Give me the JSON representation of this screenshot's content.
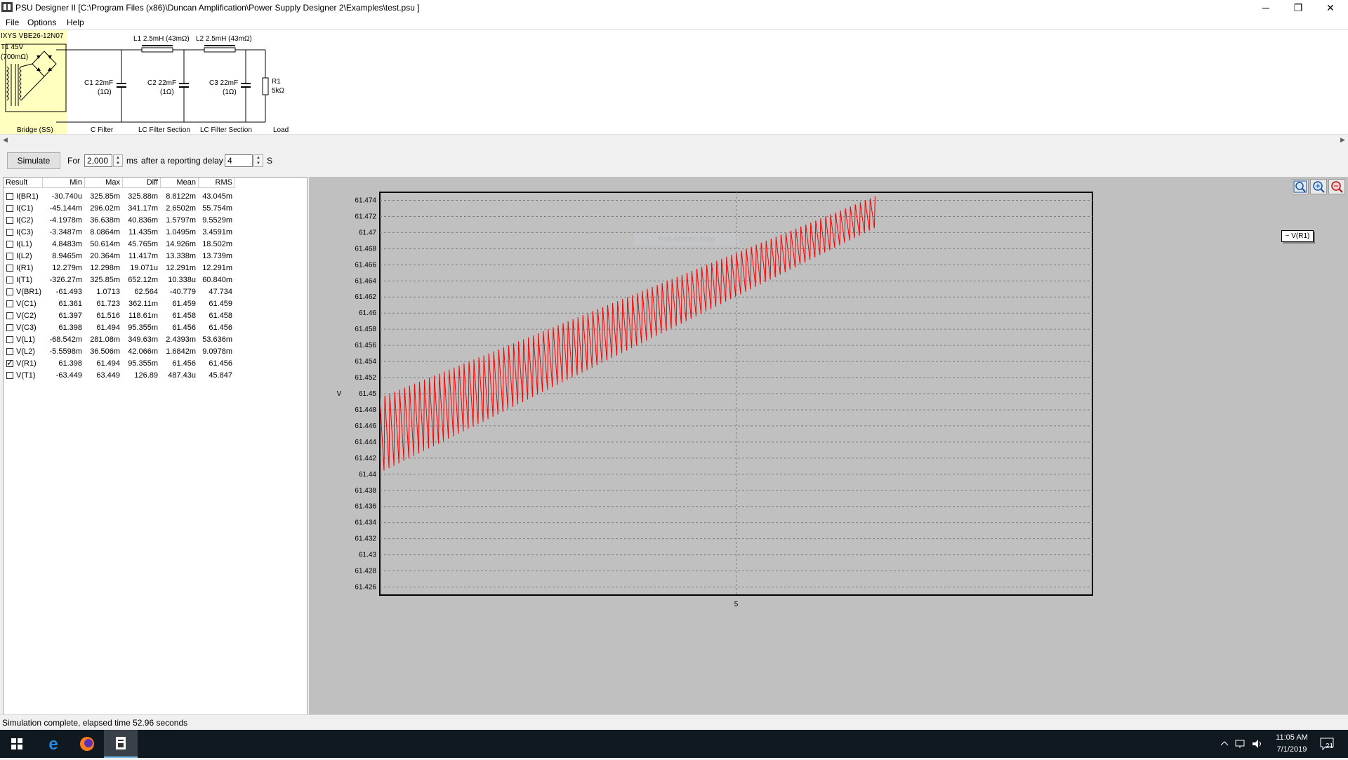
{
  "window": {
    "title": "PSU Designer II  [C:\\Program Files (x86)\\Duncan Amplification\\Power Supply Designer 2\\Examples\\test.psu ]",
    "controls": {
      "minimize": "─",
      "restore": "❐",
      "close": "✕"
    }
  },
  "menu": [
    "File",
    "Options",
    "Help"
  ],
  "schematic": {
    "rectifier": {
      "line1": "IXYS  VBE26-12N07",
      "line2": "T1 45V",
      "line3": "(700mΩ)",
      "section": "Bridge (SS)"
    },
    "c1": {
      "value": "C1 22mF",
      "esr": "(1Ω)",
      "section": "C Filter"
    },
    "l1": {
      "label": "L1 2.5mH (43mΩ)"
    },
    "c2": {
      "value": "C2 22mF",
      "esr": "(1Ω)",
      "section": "LC Filter Section"
    },
    "l2": {
      "label": "L2 2.5mH (43mΩ)"
    },
    "c3": {
      "value": "C3 22mF",
      "esr": "(1Ω)",
      "section": "LC Filter Section"
    },
    "r1": {
      "name": "R1",
      "value": "5kΩ",
      "section": "Load"
    }
  },
  "toolbar": {
    "simulate_label": "Simulate",
    "for_label": "For",
    "duration_value": "2,000",
    "ms_label": "ms",
    "delay_label": "after a reporting delay of",
    "delay_value": "4",
    "s_label": "S"
  },
  "results": {
    "columns": [
      "Result",
      "Min",
      "Max",
      "Diff",
      "Mean",
      "RMS"
    ],
    "rows": [
      {
        "name": "I(BR1)",
        "min": "-30.740u",
        "max": "325.85m",
        "diff": "325.88m",
        "mean": "8.8122m",
        "rms": "43.045m",
        "checked": false
      },
      {
        "name": "I(C1)",
        "min": "-45.144m",
        "max": "296.02m",
        "diff": "341.17m",
        "mean": "2.6502m",
        "rms": "55.754m",
        "checked": false
      },
      {
        "name": "I(C2)",
        "min": "-4.1978m",
        "max": "36.638m",
        "diff": "40.836m",
        "mean": "1.5797m",
        "rms": "9.5529m",
        "checked": false
      },
      {
        "name": "I(C3)",
        "min": "-3.3487m",
        "max": "8.0864m",
        "diff": "11.435m",
        "mean": "1.0495m",
        "rms": "3.4591m",
        "checked": false
      },
      {
        "name": "I(L1)",
        "min": "4.8483m",
        "max": "50.614m",
        "diff": "45.765m",
        "mean": "14.926m",
        "rms": "18.502m",
        "checked": false
      },
      {
        "name": "I(L2)",
        "min": "8.9465m",
        "max": "20.364m",
        "diff": "11.417m",
        "mean": "13.338m",
        "rms": "13.739m",
        "checked": false
      },
      {
        "name": "I(R1)",
        "min": "12.279m",
        "max": "12.298m",
        "diff": "19.071u",
        "mean": "12.291m",
        "rms": "12.291m",
        "checked": false
      },
      {
        "name": "I(T1)",
        "min": "-326.27m",
        "max": "325.85m",
        "diff": "652.12m",
        "mean": "10.338u",
        "rms": "60.840m",
        "checked": false
      },
      {
        "name": "V(BR1)",
        "min": "-61.493",
        "max": "1.0713",
        "diff": "62.564",
        "mean": "-40.779",
        "rms": "47.734",
        "checked": false
      },
      {
        "name": "V(C1)",
        "min": "61.361",
        "max": "61.723",
        "diff": "362.11m",
        "mean": "61.459",
        "rms": "61.459",
        "checked": false
      },
      {
        "name": "V(C2)",
        "min": "61.397",
        "max": "61.516",
        "diff": "118.61m",
        "mean": "61.458",
        "rms": "61.458",
        "checked": false
      },
      {
        "name": "V(C3)",
        "min": "61.398",
        "max": "61.494",
        "diff": "95.355m",
        "mean": "61.456",
        "rms": "61.456",
        "checked": false
      },
      {
        "name": "V(L1)",
        "min": "-68.542m",
        "max": "281.08m",
        "diff": "349.63m",
        "mean": "2.4393m",
        "rms": "53.636m",
        "checked": false
      },
      {
        "name": "V(L2)",
        "min": "-5.5598m",
        "max": "36.506m",
        "diff": "42.066m",
        "mean": "1.6842m",
        "rms": "9.0978m",
        "checked": false
      },
      {
        "name": "V(R1)",
        "min": "61.398",
        "max": "61.494",
        "diff": "95.355m",
        "mean": "61.456",
        "rms": "61.456",
        "checked": true
      },
      {
        "name": "V(T1)",
        "min": "-63.449",
        "max": "63.449",
        "diff": "126.89",
        "mean": "487.43u",
        "rms": "45.847",
        "checked": false
      }
    ]
  },
  "chart_data": {
    "type": "line",
    "title": "",
    "xlabel": "",
    "ylabel": "V",
    "ylim": [
      61.425,
      61.475
    ],
    "yticks": [
      "61.474",
      "61.472",
      "61.47",
      "61.468",
      "61.466",
      "61.464",
      "61.462",
      "61.46",
      "61.458",
      "61.456",
      "61.454",
      "61.452",
      "61.45",
      "61.448",
      "61.446",
      "61.444",
      "61.442",
      "61.44",
      "61.438",
      "61.436",
      "61.434",
      "61.432",
      "61.43",
      "61.428",
      "61.426"
    ],
    "xlim": [
      4.0,
      6.0
    ],
    "xticks": [
      "5"
    ],
    "grid": true,
    "legend_position": "right",
    "series": [
      {
        "name": "V(R1)",
        "color": "#ff0000",
        "ripple_cycles": 100,
        "x_start": 4.0,
        "x_end": 5.39,
        "trend_low": [
          61.44,
          61.4705
        ],
        "trend_high": [
          61.4495,
          61.4745
        ]
      }
    ]
  },
  "chart_tools": [
    "zoom-fit-icon",
    "zoom-in-icon",
    "zoom-out-icon"
  ],
  "overlay": {
    "watermark": "Full-screen Snip"
  },
  "status": {
    "text": "Simulation complete, elapsed time 52.96 seconds"
  },
  "taskbar": {
    "time": "11:05 AM",
    "date": "7/1/2019",
    "notifications": "21"
  }
}
